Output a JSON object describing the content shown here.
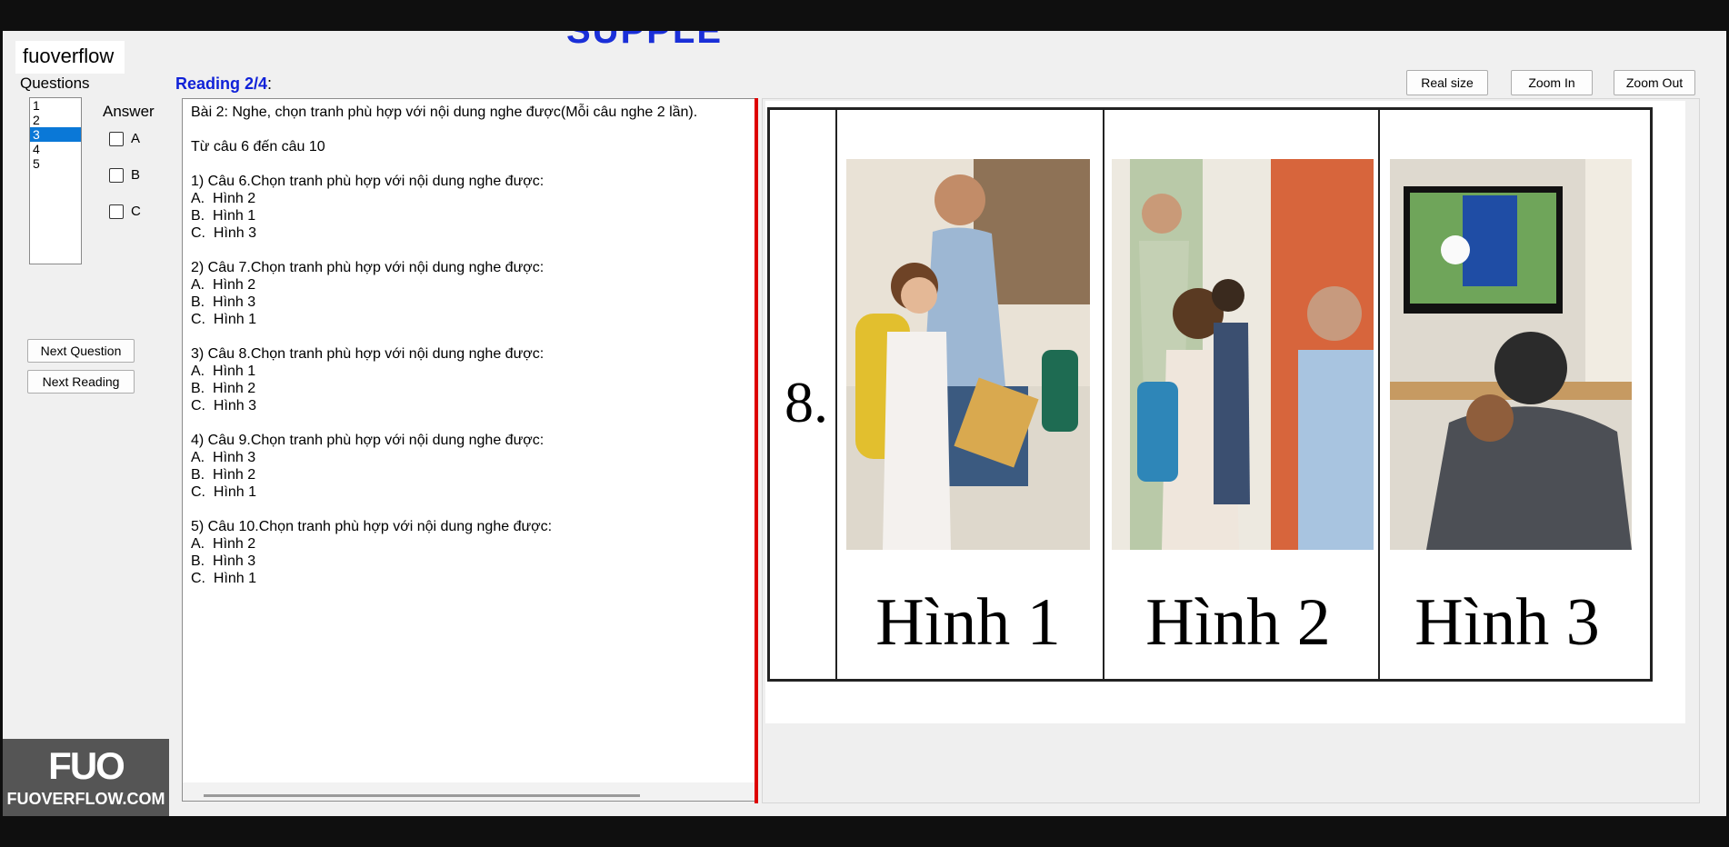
{
  "window": {
    "brand_tag": "fuoverflow",
    "top_fragment": "SUPPLE"
  },
  "sidebar": {
    "questions_label": "Questions",
    "questions": [
      "1",
      "2",
      "3",
      "4",
      "5"
    ],
    "selected_question": "3",
    "answer_label": "Answer",
    "options": [
      "A",
      "B",
      "C"
    ],
    "next_question_label": "Next Question",
    "next_reading_label": "Next Reading"
  },
  "reading": {
    "title": "Reading 2/4",
    "title_suffix": ":",
    "text": "Bài 2: Nghe, chọn tranh phù hợp với nội dung nghe được(Mỗi câu nghe 2 lần).\n\nTừ câu 6 đến câu 10\n\n1) Câu 6.Chọn tranh phù hợp với nội dung nghe được:\nA.  Hình 2\nB.  Hình 1\nC.  Hình 3\n\n2) Câu 7.Chọn tranh phù hợp với nội dung nghe được:\nA.  Hình 2\nB.  Hình 3\nC.  Hình 1\n\n3) Câu 8.Chọn tranh phù hợp với nội dung nghe được:\nA.  Hình 1\nB.  Hình 2\nC.  Hình 3\n\n4) Câu 9.Chọn tranh phù hợp với nội dung nghe được:\nA.  Hình 3\nB.  Hình 2\nC.  Hình 1\n\n5) Câu 10.Chọn tranh phù hợp với nội dung nghe được:\nA.  Hình 2\nB.  Hình 3\nC.  Hình 1"
  },
  "image_toolbar": {
    "real_size_label": "Real size",
    "zoom_in_label": "Zoom In",
    "zoom_out_label": "Zoom Out"
  },
  "question_image": {
    "number": "8.",
    "captions": [
      "Hình 1",
      "Hình 2",
      "Hình 3"
    ]
  },
  "watermark": {
    "logo_text": "FUO",
    "site": "FUOVERFLOW.COM"
  }
}
